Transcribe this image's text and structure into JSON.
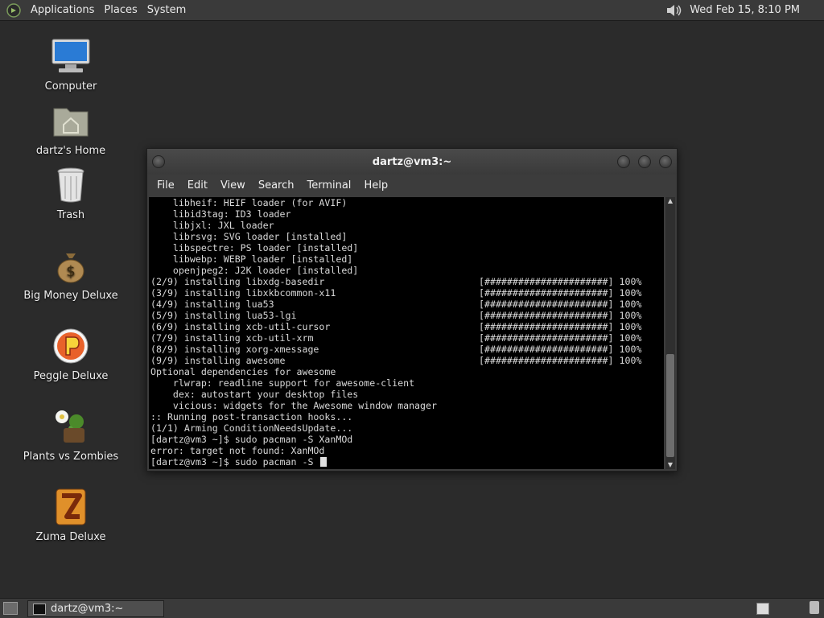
{
  "top_panel": {
    "menus": [
      "Applications",
      "Places",
      "System"
    ],
    "clock": "Wed Feb 15,  8:10 PM",
    "icons": {
      "logo": "gnome-foot-icon",
      "volume": "volume-icon"
    }
  },
  "desktop": {
    "icons": [
      {
        "label": "Computer",
        "icon": "computer-icon"
      },
      {
        "label": "dartz's Home",
        "icon": "home-folder-icon"
      },
      {
        "label": "Trash",
        "icon": "trash-icon"
      },
      {
        "label": "Big Money Deluxe",
        "icon": "money-bag-icon"
      },
      {
        "label": "Peggle Deluxe",
        "icon": "peggle-icon"
      },
      {
        "label": "Plants vs Zombies",
        "icon": "plants-vs-zombies-icon"
      },
      {
        "label": "Zuma Deluxe",
        "icon": "zuma-icon"
      }
    ]
  },
  "terminal": {
    "title": "dartz@vm3:~",
    "menus": [
      "File",
      "Edit",
      "View",
      "Search",
      "Terminal",
      "Help"
    ],
    "lines": [
      {
        "text": "    libheif: HEIF loader (for AVIF)",
        "bar": ""
      },
      {
        "text": "    libid3tag: ID3 loader",
        "bar": ""
      },
      {
        "text": "    libjxl: JXL loader",
        "bar": ""
      },
      {
        "text": "    librsvg: SVG loader [installed]",
        "bar": ""
      },
      {
        "text": "    libspectre: PS loader [installed]",
        "bar": ""
      },
      {
        "text": "    libwebp: WEBP loader [installed]",
        "bar": ""
      },
      {
        "text": "    openjpeg2: J2K loader [installed]",
        "bar": ""
      },
      {
        "text": "(2/9) installing libxdg-basedir",
        "bar": "[######################] 100%"
      },
      {
        "text": "(3/9) installing libxkbcommon-x11",
        "bar": "[######################] 100%"
      },
      {
        "text": "(4/9) installing lua53",
        "bar": "[######################] 100%"
      },
      {
        "text": "(5/9) installing lua53-lgi",
        "bar": "[######################] 100%"
      },
      {
        "text": "(6/9) installing xcb-util-cursor",
        "bar": "[######################] 100%"
      },
      {
        "text": "(7/9) installing xcb-util-xrm",
        "bar": "[######################] 100%"
      },
      {
        "text": "(8/9) installing xorg-xmessage",
        "bar": "[######################] 100%"
      },
      {
        "text": "(9/9) installing awesome",
        "bar": "[######################] 100%"
      },
      {
        "text": "Optional dependencies for awesome",
        "bar": ""
      },
      {
        "text": "    rlwrap: readline support for awesome-client",
        "bar": ""
      },
      {
        "text": "    dex: autostart your desktop files",
        "bar": ""
      },
      {
        "text": "    vicious: widgets for the Awesome window manager",
        "bar": ""
      },
      {
        "text": ":: Running post-transaction hooks...",
        "bar": ""
      },
      {
        "text": "(1/1) Arming ConditionNeedsUpdate...",
        "bar": ""
      },
      {
        "text": "[dartz@vm3 ~]$ sudo pacman -S XanMOd",
        "bar": ""
      },
      {
        "text": "error: target not found: XanMOd",
        "bar": ""
      }
    ],
    "prompt": "[dartz@vm3 ~]$ sudo pacman -S "
  },
  "bottom_panel": {
    "task_label": "dartz@vm3:~"
  }
}
